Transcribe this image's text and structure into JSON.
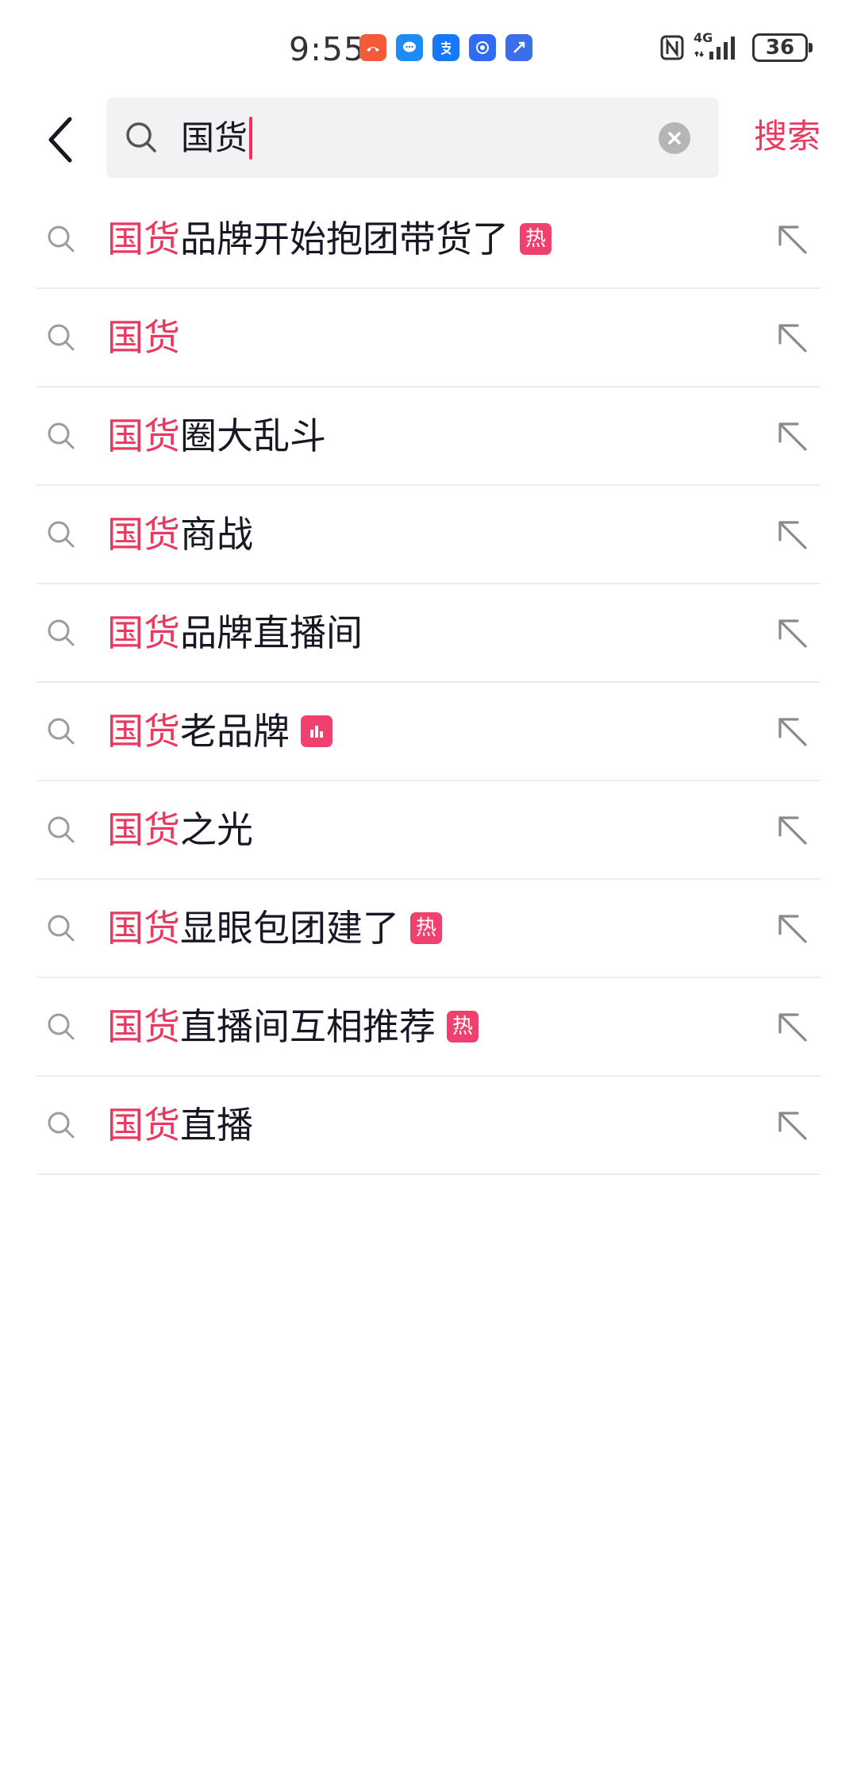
{
  "status_bar": {
    "time": "9:55",
    "network": "4G",
    "battery": "36",
    "app_icons": [
      {
        "name": "missed-call-icon",
        "color": "#f25a3a"
      },
      {
        "name": "message-icon",
        "color": "#1e8cf5"
      },
      {
        "name": "alipay-icon",
        "color": "#1677ff"
      },
      {
        "name": "app-icon",
        "color": "#2f6bf3"
      },
      {
        "name": "app-icon",
        "color": "#3b6ee8"
      }
    ]
  },
  "search": {
    "query": "国货",
    "submit_label": "搜索"
  },
  "suggestions": [
    {
      "match": "国货",
      "rest": "品牌开始抱团带货了",
      "tag": "热"
    },
    {
      "match": "国货",
      "rest": "",
      "tag": ""
    },
    {
      "match": "国货",
      "rest": "圈大乱斗",
      "tag": ""
    },
    {
      "match": "国货",
      "rest": "商战",
      "tag": ""
    },
    {
      "match": "国货",
      "rest": "品牌直播间",
      "tag": ""
    },
    {
      "match": "国货",
      "rest": "老品牌",
      "tag": "chart"
    },
    {
      "match": "国货",
      "rest": "之光",
      "tag": ""
    },
    {
      "match": "国货",
      "rest": "显眼包团建了",
      "tag": "热"
    },
    {
      "match": "国货",
      "rest": "直播间互相推荐",
      "tag": "热"
    },
    {
      "match": "国货",
      "rest": "直播",
      "tag": ""
    }
  ],
  "colors": {
    "highlight": "#e83a5f",
    "tag_bg": "#f0416e",
    "divider": "#ededed",
    "search_bg": "#f2f2f4"
  }
}
